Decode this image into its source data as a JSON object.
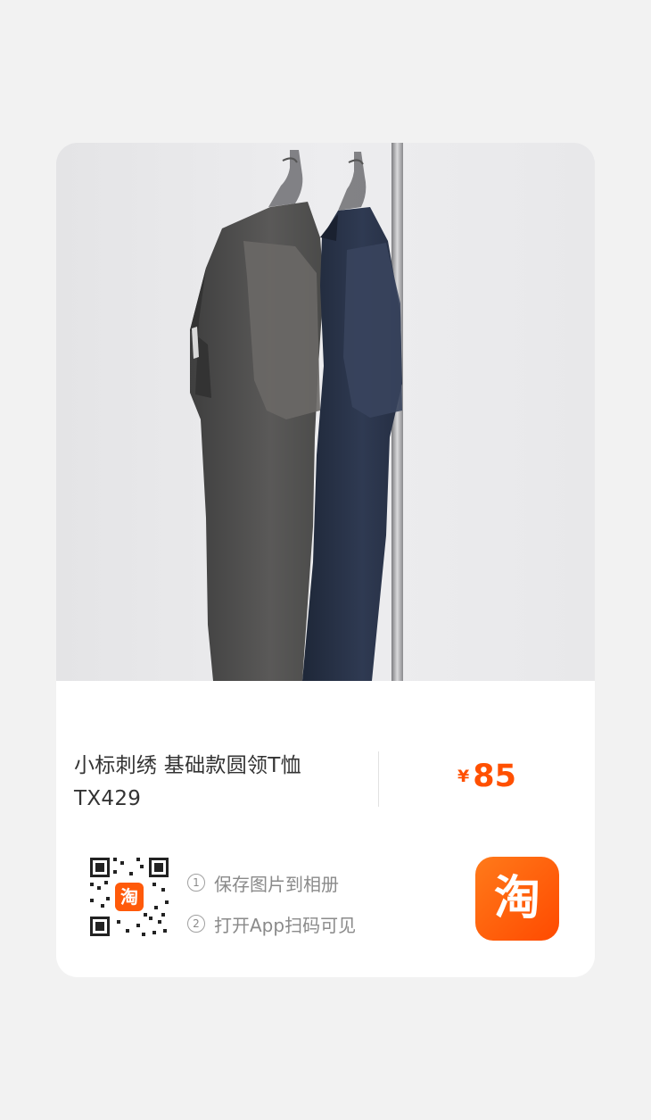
{
  "product": {
    "title": "小标刺绣 基础款圆领T恤 TX429",
    "price_symbol": "¥",
    "price_value": "85"
  },
  "share": {
    "qr_badge_text": "淘",
    "steps": [
      {
        "number": "1",
        "text": "保存图片到相册"
      },
      {
        "number": "2",
        "text": "打开App扫码可见"
      }
    ],
    "app_logo_text": "淘"
  },
  "colors": {
    "accent": "#ff5000",
    "logo_gradient_start": "#ff7a1a",
    "logo_gradient_end": "#ff4a00",
    "page_background": "#f2f2f2",
    "card_background": "#ffffff"
  },
  "icons": [
    "qr-code-icon",
    "taobao-logo-icon",
    "circle-number-icon"
  ]
}
